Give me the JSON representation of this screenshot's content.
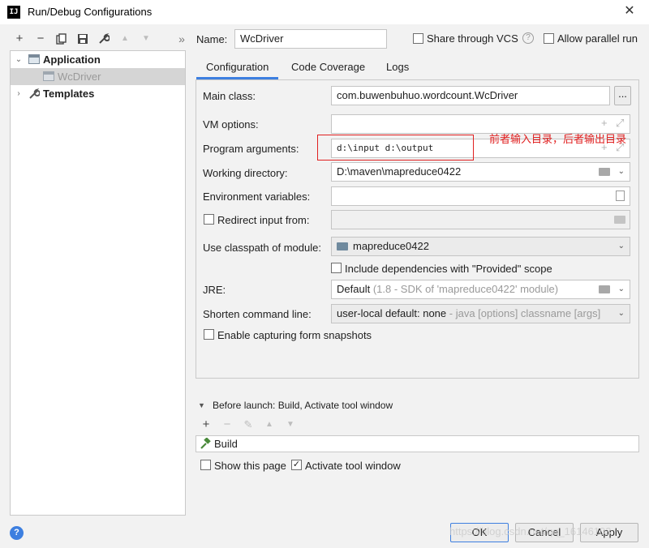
{
  "window": {
    "title": "Run/Debug Configurations",
    "app_icon_text": "IJ"
  },
  "toolbar": {
    "items": [
      {
        "icon": "plus-icon",
        "glyph": "+"
      },
      {
        "icon": "minus-icon",
        "glyph": "−"
      },
      {
        "icon": "copy-icon",
        "glyph": "⧉"
      },
      {
        "icon": "save-icon",
        "glyph": "🖫"
      },
      {
        "icon": "wrench-icon",
        "glyph": "🔧"
      },
      {
        "icon": "arrow-up-icon",
        "glyph": "▲"
      },
      {
        "icon": "arrow-down-icon",
        "glyph": "▼"
      },
      {
        "icon": "double-chevron-right-icon",
        "glyph": "»"
      }
    ]
  },
  "tree": {
    "items": [
      {
        "label": "Application"
      },
      {
        "label": "WcDriver"
      },
      {
        "label": "Templates"
      }
    ]
  },
  "header": {
    "name_label": "Name:",
    "name_value": "WcDriver",
    "share_label": "Share through VCS",
    "parallel_label": "Allow parallel run"
  },
  "tabs": [
    {
      "label": "Configuration"
    },
    {
      "label": "Code Coverage"
    },
    {
      "label": "Logs"
    }
  ],
  "config": {
    "main_class_label": "Main class:",
    "main_class_value": "com.buwenbuhuo.wordcount.WcDriver",
    "browse_label": "...",
    "vm_options_label": "VM options:",
    "vm_options_value": "",
    "program_args_label": "Program arguments:",
    "program_args_value": "d:\\input  d:\\output",
    "working_dir_label": "Working directory:",
    "working_dir_value": "D:\\maven\\mapreduce0422",
    "env_vars_label": "Environment variables:",
    "env_vars_value": "",
    "redirect_label": "Redirect input from:",
    "classpath_label": "Use classpath of module:",
    "classpath_value": "mapreduce0422",
    "include_deps_label": "Include dependencies with \"Provided\" scope",
    "jre_label": "JRE:",
    "jre_value": "Default",
    "jre_hint": " (1.8 - SDK of 'mapreduce0422' module)",
    "shorten_label": "Shorten command line:",
    "shorten_value": "user-local default: none",
    "shorten_hint": " - java [options] classname [args]",
    "capture_label": "Enable capturing form snapshots"
  },
  "annotation": {
    "text": "前者输入目录，后者输出目录"
  },
  "before_launch": {
    "title": "Before launch: Build, Activate tool window",
    "items": [
      {
        "label": "Build"
      }
    ],
    "show_page_label": "Show this page",
    "activate_label": "Activate tool window",
    "show_page_checked": false,
    "activate_checked": true
  },
  "buttons": {
    "ok": "OK",
    "cancel": "Cancel",
    "apply": "Apply"
  },
  "watermark": "https://blog.csdn.net/qq_16146103",
  "colors": {
    "accent": "#3d7fe0",
    "annotation": "#e02020",
    "selection": "#d5d5d5"
  }
}
